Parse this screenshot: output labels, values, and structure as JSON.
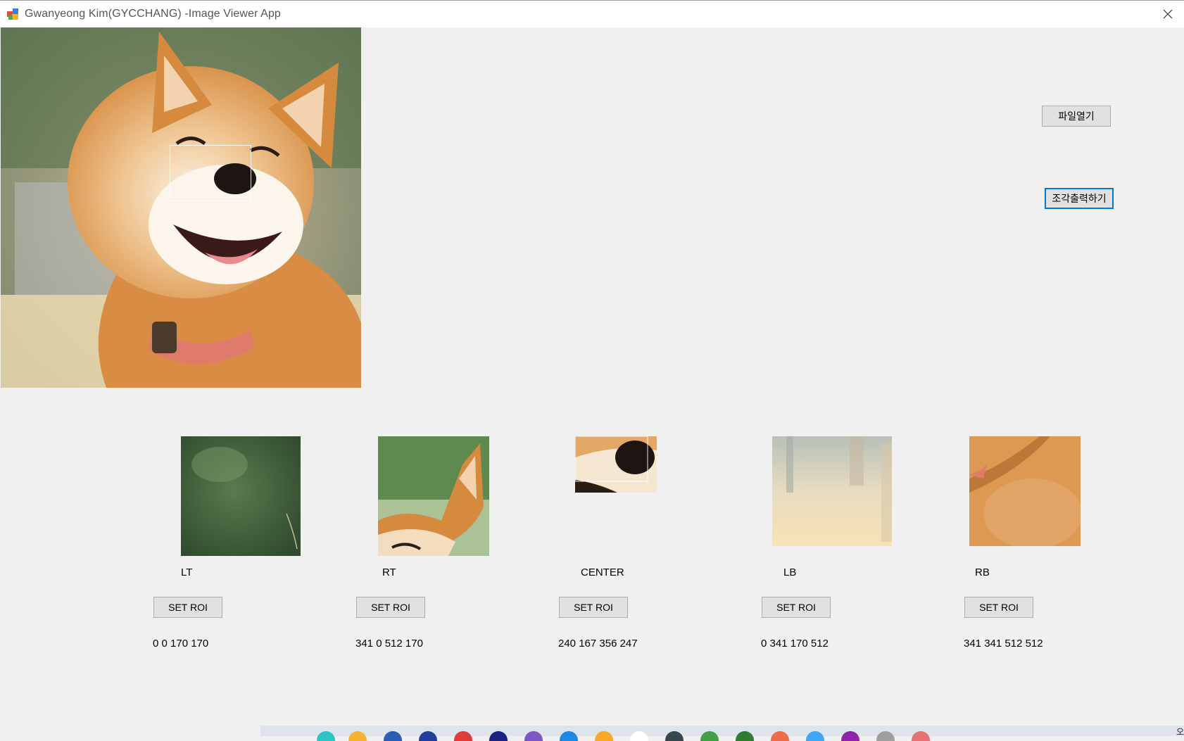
{
  "window": {
    "title": "Gwanyeong Kim(GYCCHANG) -Image Viewer App"
  },
  "buttons": {
    "open_file": "파일열기",
    "print_pieces": "조각출력하기"
  },
  "pieces": [
    {
      "label": "LT",
      "button": "SET ROI",
      "coords": "0 0 170 170"
    },
    {
      "label": "RT",
      "button": "SET ROI",
      "coords": "341 0 512 170"
    },
    {
      "label": "CENTER",
      "button": "SET ROI",
      "coords": "240 167 356 247"
    },
    {
      "label": "LB",
      "button": "SET ROI",
      "coords": "0 341 170 512"
    },
    {
      "label": "RB",
      "button": "SET ROI",
      "coords": "341 341 512 512"
    }
  ],
  "taskbar": {
    "corner_text": "오"
  },
  "colors": {
    "accent": "#0078d7",
    "fur": "#d9934a",
    "background": "#f0f0f0"
  }
}
